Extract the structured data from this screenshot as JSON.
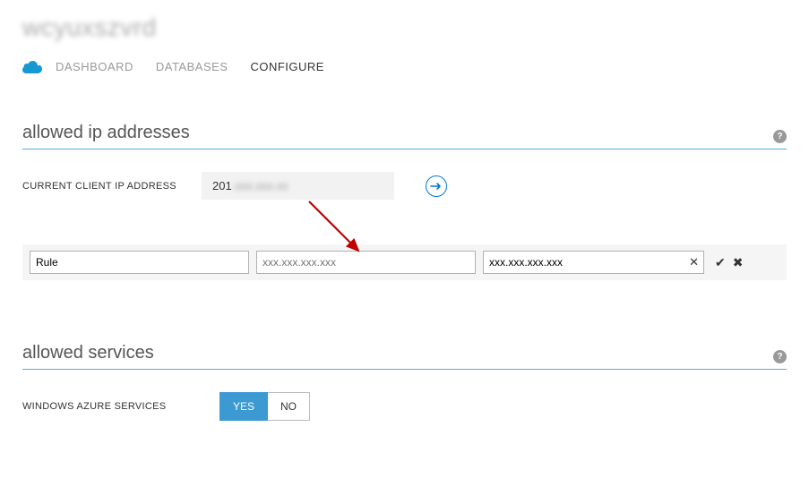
{
  "header": {
    "server_name": "wcyuxszvrd"
  },
  "tabs": {
    "dashboard": "DASHBOARD",
    "databases": "DATABASES",
    "configure": "CONFIGURE"
  },
  "allowed_ip": {
    "title": "allowed ip addresses",
    "help": "?",
    "current_label": "CURRENT CLIENT IP ADDRESS",
    "current_value_prefix": "201",
    "current_value_blurred": ".xxx.xxx.xx",
    "rule": {
      "name_value": "Rule",
      "start_placeholder": "xxx.xxx.xxx.xxx",
      "end_value": "xxx.xxx.xxx.xxx"
    }
  },
  "allowed_services": {
    "title": "allowed services",
    "help": "?",
    "label": "WINDOWS AZURE SERVICES",
    "yes": "YES",
    "no": "NO"
  }
}
